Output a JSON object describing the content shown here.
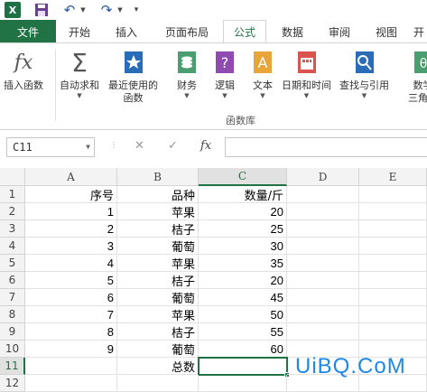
{
  "qat": {
    "app_icon": "excel-icon",
    "save_icon": "save-icon",
    "undo_icon": "undo-icon",
    "redo_icon": "redo-icon",
    "customize_icon": "customize-icon"
  },
  "tabs": [
    {
      "label": "文件"
    },
    {
      "label": "开始"
    },
    {
      "label": "插入"
    },
    {
      "label": "页面布局"
    },
    {
      "label": "公式"
    },
    {
      "label": "数据"
    },
    {
      "label": "审阅"
    },
    {
      "label": "视图"
    },
    {
      "label": "开"
    }
  ],
  "ribbon": {
    "insert_function": "插入函数",
    "autosum": "自动求和",
    "recent": "最近使用的",
    "recent2": "函数",
    "financial": "财务",
    "logical": "逻辑",
    "text": "文本",
    "datetime": "日期和时间",
    "lookup": "查找与引用",
    "math": "数学",
    "math2": "三角函",
    "group_label": "函数库"
  },
  "formula_bar": {
    "name_box": "C11",
    "cancel": "✕",
    "enter": "✓",
    "fx": "fx",
    "formula": ""
  },
  "grid": {
    "columns": [
      "A",
      "B",
      "C",
      "D",
      "E"
    ],
    "selected_column": "C",
    "selected_row": "11",
    "rows": [
      {
        "num": "1",
        "a": "序号",
        "b": "品种",
        "c": "数量/斤"
      },
      {
        "num": "2",
        "a": "1",
        "b": "苹果",
        "c": "20"
      },
      {
        "num": "3",
        "a": "2",
        "b": "桔子",
        "c": "25"
      },
      {
        "num": "4",
        "a": "3",
        "b": "葡萄",
        "c": "30"
      },
      {
        "num": "5",
        "a": "4",
        "b": "苹果",
        "c": "35"
      },
      {
        "num": "6",
        "a": "5",
        "b": "桔子",
        "c": "20"
      },
      {
        "num": "7",
        "a": "6",
        "b": "葡萄",
        "c": "45"
      },
      {
        "num": "8",
        "a": "7",
        "b": "苹果",
        "c": "50"
      },
      {
        "num": "9",
        "a": "8",
        "b": "桔子",
        "c": "55"
      },
      {
        "num": "10",
        "a": "9",
        "b": "葡萄",
        "c": "60"
      },
      {
        "num": "11",
        "a": "",
        "b": "总数",
        "c": ""
      },
      {
        "num": "12",
        "a": "",
        "b": "",
        "c": ""
      }
    ]
  },
  "watermark": "UiBQ.CoM",
  "colors": {
    "accent": "#217346",
    "watermark": "#1e88e5"
  }
}
